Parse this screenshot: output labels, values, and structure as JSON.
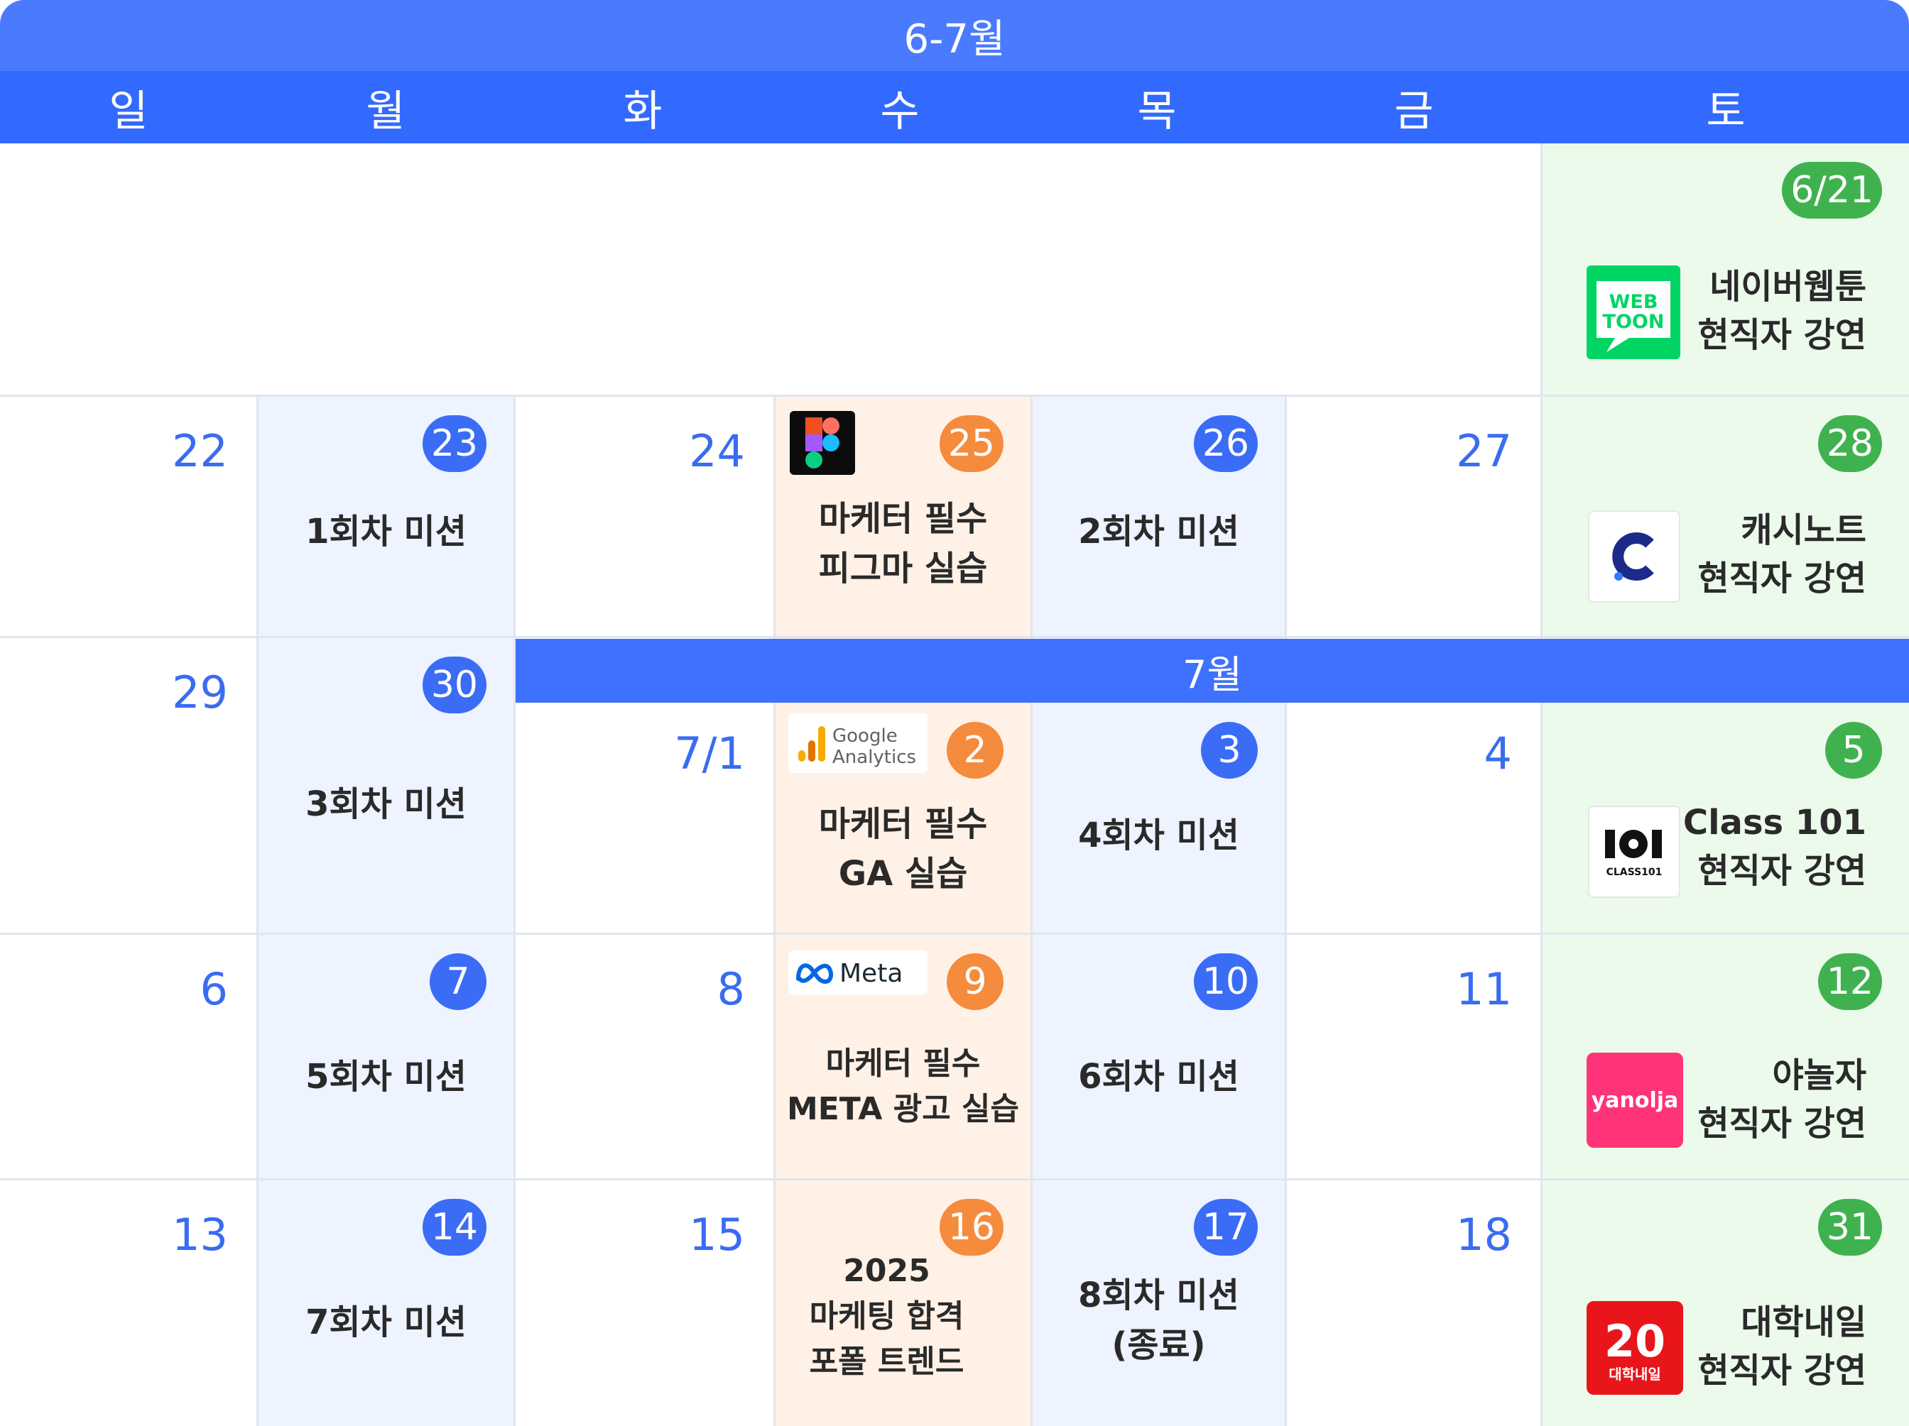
{
  "header": {
    "title": "6-7월"
  },
  "weekdays": [
    "일",
    "월",
    "화",
    "수",
    "목",
    "금",
    "토"
  ],
  "july_banner": "7월",
  "colors": {
    "primary": "#3269ff",
    "mission": "#edf3ff",
    "marketing": "#fff1e6",
    "lecture": "#ecfaeb"
  },
  "week0": {
    "sat": {
      "date": "6/21",
      "line1": "네이버웹툰",
      "line2": "현직자 강연",
      "logo": "webtoon-logo",
      "logo_text1": "WEB",
      "logo_text2": "TOON"
    }
  },
  "week1": {
    "sun": {
      "date": "22"
    },
    "mon": {
      "date": "23",
      "label": "1회차 미션"
    },
    "tue": {
      "date": "24"
    },
    "wed": {
      "date": "25",
      "line1": "마케터 필수",
      "line2": "피그마 실습",
      "logo": "figma-logo"
    },
    "thu": {
      "date": "26",
      "label": "2회차 미션"
    },
    "fri": {
      "date": "27"
    },
    "sat": {
      "date": "28",
      "line1": "캐시노트",
      "line2": "현직자 강연",
      "logo": "cashnote-logo"
    }
  },
  "week2": {
    "sun": {
      "date": "29"
    },
    "mon": {
      "date": "30",
      "label": "3회차 미션"
    },
    "tue": {
      "date": "7/1"
    },
    "wed": {
      "date": "2",
      "line1": "마케터 필수",
      "line2": "GA 실습",
      "logo": "google-analytics-logo",
      "logo_text1": "Google",
      "logo_text2": "Analytics"
    },
    "thu": {
      "date": "3",
      "label": "4회차 미션"
    },
    "fri": {
      "date": "4"
    },
    "sat": {
      "date": "5",
      "line1": "Class 101",
      "line2": "현직자 강연",
      "logo": "class101-logo",
      "logo_text1": "CLASS101"
    }
  },
  "week3": {
    "sun": {
      "date": "6"
    },
    "mon": {
      "date": "7",
      "label": "5회차 미션"
    },
    "tue": {
      "date": "8"
    },
    "wed": {
      "date": "9",
      "line1": "마케터 필수",
      "line2": "META 광고 실습",
      "logo": "meta-logo",
      "logo_text1": "Meta"
    },
    "thu": {
      "date": "10",
      "label": "6회차 미션"
    },
    "fri": {
      "date": "11"
    },
    "sat": {
      "date": "12",
      "line1": "야놀자",
      "line2": "현직자 강연",
      "logo": "yanolja-logo",
      "logo_text1": "yanolja"
    }
  },
  "week4": {
    "sun": {
      "date": "13"
    },
    "mon": {
      "date": "14",
      "label": "7회차 미션"
    },
    "tue": {
      "date": "15"
    },
    "wed": {
      "date": "16",
      "line1": "2025",
      "line2": "마케팅 합격",
      "line3": "포폴 트렌드"
    },
    "thu": {
      "date": "17",
      "line1": "8회차 미션",
      "line2": "(종료)"
    },
    "fri": {
      "date": "18"
    },
    "sat": {
      "date": "31",
      "line1": "대학내일",
      "line2": "현직자 강연",
      "logo": "daehaknaeil-logo",
      "logo_text1": "20",
      "logo_text2": "대학내일"
    }
  }
}
